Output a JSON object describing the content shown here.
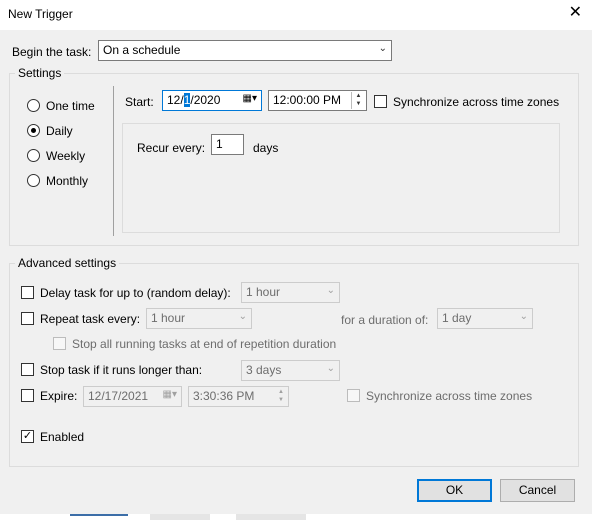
{
  "window": {
    "title": "New Trigger",
    "close_glyph": "✕"
  },
  "begin": {
    "label": "Begin the task:",
    "value": "On a schedule"
  },
  "settings": {
    "group_label": "Settings",
    "radios": [
      {
        "label": "One time",
        "checked": false
      },
      {
        "label": "Daily",
        "checked": true
      },
      {
        "label": "Weekly",
        "checked": false
      },
      {
        "label": "Monthly",
        "checked": false
      }
    ],
    "start_label": "Start:",
    "start_date_before": "12/",
    "start_date_selected": "1",
    "start_date_after": "/2020",
    "start_time": "12:00:00 PM",
    "sync_label": "Synchronize across time zones",
    "recur_label": "Recur every:",
    "recur_value": "1",
    "recur_unit": "days"
  },
  "advanced": {
    "group_label": "Advanced settings",
    "delay_label": "Delay task for up to (random delay):",
    "delay_value": "1 hour",
    "repeat_label": "Repeat task every:",
    "repeat_value": "1 hour",
    "duration_label": "for a duration of:",
    "duration_value": "1 day",
    "stop_all_label": "Stop all running tasks at end of repetition duration",
    "stop_longer_label": "Stop task if it runs longer than:",
    "stop_longer_value": "3 days",
    "expire_label": "Expire:",
    "expire_date": "12/17/2021",
    "expire_time": "3:30:36 PM",
    "expire_sync_label": "Synchronize across time zones",
    "enabled_label": "Enabled",
    "enabled_checked": true
  },
  "buttons": {
    "ok": "OK",
    "cancel": "Cancel"
  },
  "colors": {
    "accent": "#0078d7",
    "dialog_bg": "#f0f0f0"
  }
}
